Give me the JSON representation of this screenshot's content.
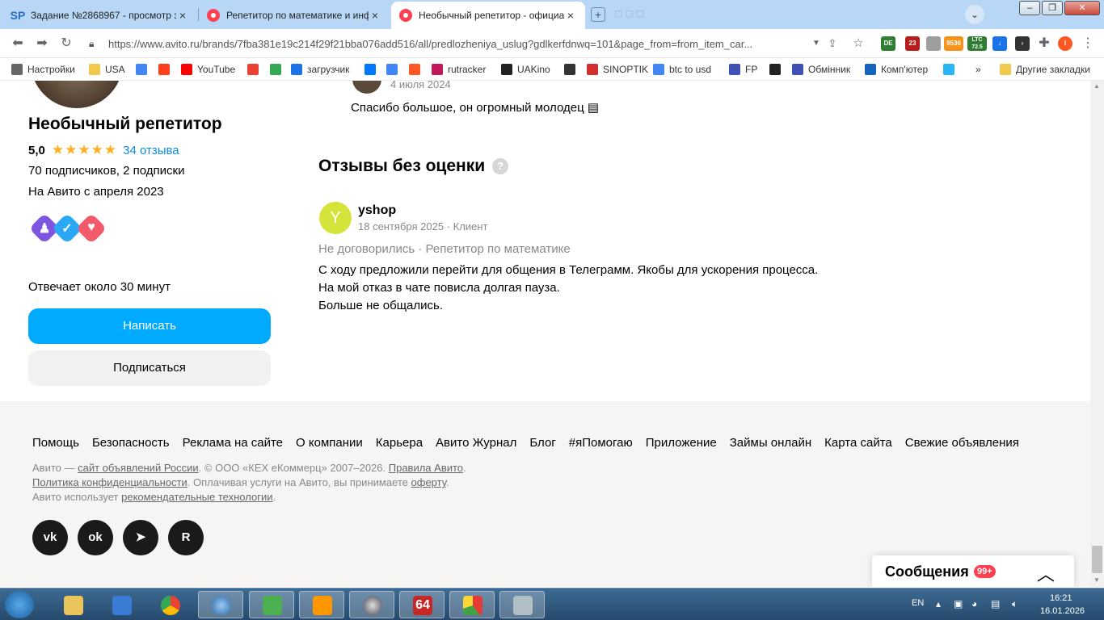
{
  "browser": {
    "tabs": [
      {
        "label": "Задание №2868967 - просмотр з",
        "icon": "sp-icon"
      },
      {
        "label": "Репетитор по математике и инфо",
        "icon": "avito-icon"
      },
      {
        "label": "Необычный репетитор - официа",
        "icon": "avito-icon"
      }
    ],
    "url": "https://www.avito.ru/brands/7fba381e19c214f29f21bba076add516/all/predlozheniya_uslug?gdlkerfdnwq=101&page_from=from_item_car...",
    "extension_labels": {
      "de": "DE",
      "num23": "23",
      "num9536": "9536",
      "ltc": "LTC",
      "ltc_value": "72.5"
    }
  },
  "bookmarks": [
    {
      "label": "Настройки",
      "color": "#666666"
    },
    {
      "label": "USA",
      "color": "#f2c94c"
    },
    {
      "label": "",
      "color": "#4285f4"
    },
    {
      "label": "",
      "color": "#fc3f1d"
    },
    {
      "label": "YouTube",
      "color": "#ff0000"
    },
    {
      "label": "",
      "color": "#ea4335"
    },
    {
      "label": "",
      "color": "#34a853"
    },
    {
      "label": "загрузчик",
      "color": "#1a73e8"
    },
    {
      "label": "",
      "color": "#0077ff"
    },
    {
      "label": "",
      "color": "#4285f4"
    },
    {
      "label": "",
      "color": "#ff5722"
    },
    {
      "label": "rutracker",
      "color": "#c2185b"
    },
    {
      "label": "UAKino",
      "color": "#222222"
    },
    {
      "label": "",
      "color": "#333333"
    },
    {
      "label": "SINOPTIK",
      "color": "#d32f2f"
    },
    {
      "label": "btc to usd",
      "color": "#4285f4"
    },
    {
      "label": "FP",
      "color": "#3f51b5"
    },
    {
      "label": "",
      "color": "#222222"
    },
    {
      "label": "Обмінник",
      "color": "#3f51b5"
    },
    {
      "label": "Комп'ютер",
      "color": "#1565c0"
    },
    {
      "label": "",
      "color": "#29b6f6"
    },
    {
      "label": "Другие закладки",
      "color": "#f2c94c"
    }
  ],
  "bookmarks_more": "»",
  "seller": {
    "name": "Необычный репетитор",
    "rating": "5,0",
    "stars": 5,
    "reviews_link": "34 отзыва",
    "subscribers": "70 подписчиков, 2 подписки",
    "since": "На Авито с апреля 2023",
    "reply_time": "Отвечает около 30 минут",
    "write_button": "Написать",
    "subscribe_button": "Подписаться"
  },
  "previous_review": {
    "date": "4 июля 2024",
    "text": "Спасибо большое, он огромный молодец ▤"
  },
  "section": {
    "title": "Отзывы без оценки",
    "help_icon": "?"
  },
  "review": {
    "avatar_letter": "Y",
    "author": "yshop",
    "meta": "18 сентября 2025 · Клиент",
    "deal": "Не договорились · Репетитор по математике",
    "lines": [
      "С ходу предложили перейти для общения в Телеграмм. Якобы для ускорения процесса.",
      "На мой отказ в чате повисла долгая пауза.",
      "Больше не общались."
    ]
  },
  "footer": {
    "links": [
      "Помощь",
      "Безопасность",
      "Реклама на сайте",
      "О компании",
      "Карьера",
      "Авито Журнал",
      "Блог",
      "#яПомогаю",
      "Приложение",
      "Займы онлайн",
      "Карта сайта",
      "Свежие объявления"
    ],
    "legal1_pre": "Авито — ",
    "legal1_link1": "сайт объявлений России",
    "legal1_mid": ". © ООО «КЕХ еКоммерц» 2007–2026. ",
    "legal1_link2": "Правила Авито",
    "legal1_end": ".",
    "legal2_link1": "Политика конфиденциальности",
    "legal2_mid": ". Оплачивая услуги на Авито, вы принимаете ",
    "legal2_link2": "оферту",
    "legal2_end": ".",
    "legal3_pre": "Авито использует ",
    "legal3_link": "рекомендательные технологии",
    "legal3_end": ".",
    "social": [
      "vk",
      "ok",
      "telegram",
      "rutube"
    ]
  },
  "messages_widget": {
    "title": "Сообщения",
    "count": "99+"
  },
  "taskbar": {
    "language": "EN",
    "time": "16:21",
    "date": "16.01.2026",
    "badge_64": "64"
  }
}
